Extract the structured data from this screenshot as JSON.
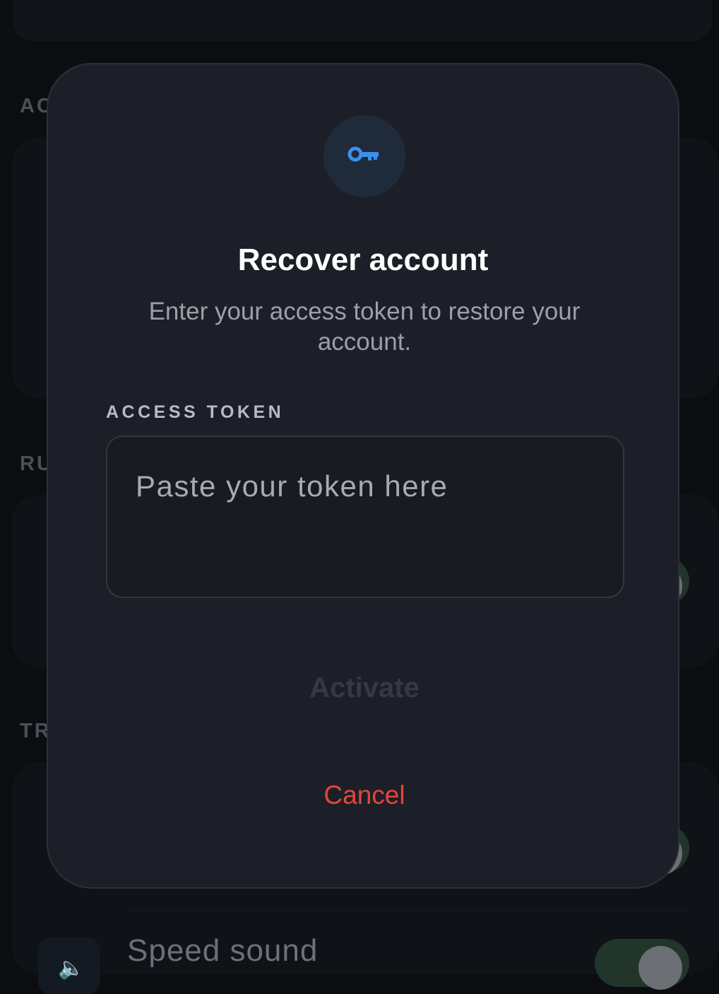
{
  "background": {
    "section_labels": [
      "AC",
      "RU",
      "TR"
    ],
    "row_label": "Speed sound",
    "row_icon": "speaker-icon"
  },
  "dialog": {
    "icon": "key-icon",
    "title": "Recover account",
    "subtitle": "Enter your access token to restore your account.",
    "field_label": "ACCESS TOKEN",
    "token_value": "",
    "token_placeholder": "Paste your token here",
    "activate_label": "Activate",
    "cancel_label": "Cancel"
  },
  "colors": {
    "accent": "#3b8ff0",
    "danger": "#e5453b",
    "modal_bg": "#1c1f28",
    "disabled_text": "#343945"
  }
}
